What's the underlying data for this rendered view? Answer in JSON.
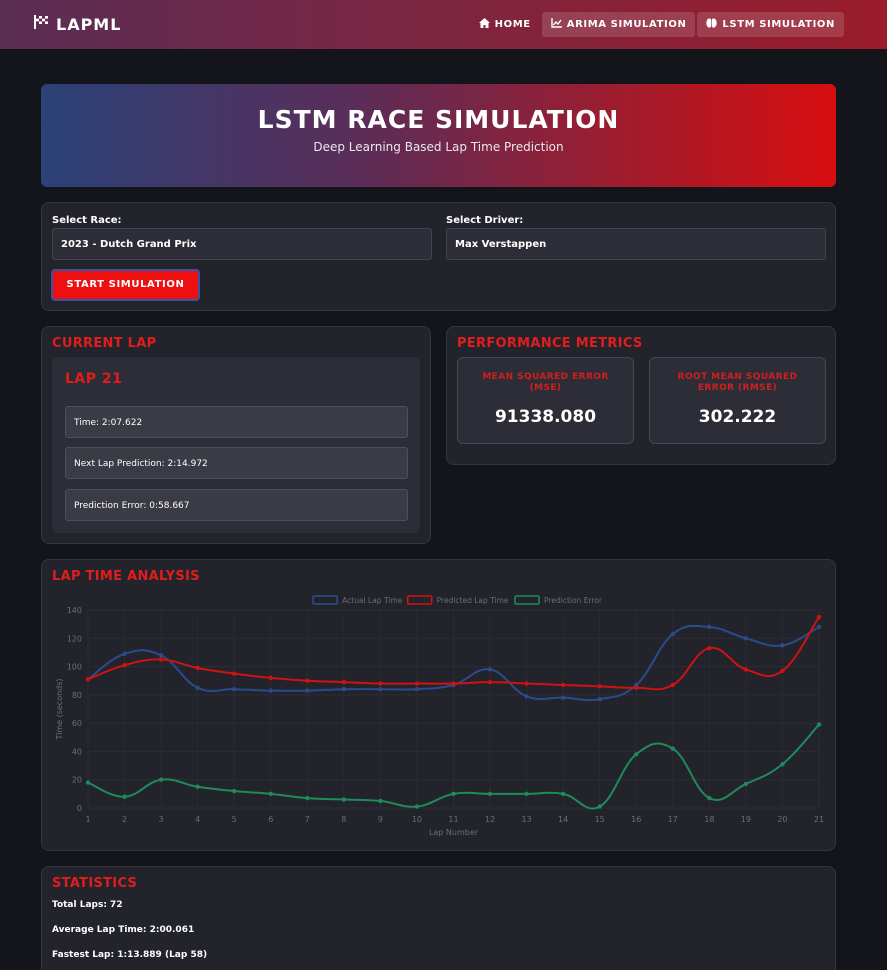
{
  "nav": {
    "brand": "LAPML",
    "links": [
      "HOME",
      "ARIMA SIMULATION",
      "LSTM SIMULATION"
    ]
  },
  "hero": {
    "title": "LSTM RACE SIMULATION",
    "subtitle": "Deep Learning Based Lap Time Prediction"
  },
  "form": {
    "race_label": "Select Race:",
    "race_value": "2023 - Dutch Grand Prix",
    "driver_label": "Select Driver:",
    "driver_value": "Max Verstappen",
    "start_label": "START SIMULATION"
  },
  "current_lap": {
    "title": "CURRENT LAP",
    "lap": "LAP 21",
    "time": "Time: 2:07.622",
    "next_prediction": "Next Lap Prediction: 2:14.972",
    "error": "Prediction Error: 0:58.667"
  },
  "metrics": {
    "title": "PERFORMANCE METRICS",
    "mse_label": "MEAN SQUARED ERROR (MSE)",
    "mse_value": "91338.080",
    "rmse_label": "ROOT MEAN SQUARED ERROR (RMSE)",
    "rmse_value": "302.222"
  },
  "analysis": {
    "title": "LAP TIME ANALYSIS"
  },
  "chart_data": {
    "type": "line",
    "title": "",
    "xlabel": "Lap Number",
    "ylabel": "Time (seconds)",
    "x": [
      1,
      2,
      3,
      4,
      5,
      6,
      7,
      8,
      9,
      10,
      11,
      12,
      13,
      14,
      15,
      16,
      17,
      18,
      19,
      20,
      21
    ],
    "ylim": [
      0,
      140
    ],
    "yticks": [
      0,
      20,
      40,
      60,
      80,
      100,
      120,
      140
    ],
    "legend": "top",
    "grid": true,
    "series": [
      {
        "name": "Actual Lap Time",
        "color": "#2b4c8c",
        "values": [
          91,
          109,
          108,
          85,
          84,
          83,
          83,
          84,
          84,
          84,
          87,
          98,
          79,
          78,
          77,
          87,
          123,
          128,
          120,
          115,
          128
        ]
      },
      {
        "name": "Predicted Lap Time",
        "color": "#d01212",
        "values": [
          91,
          101,
          105,
          99,
          95,
          92,
          90,
          89,
          88,
          88,
          88,
          89,
          88,
          87,
          86,
          85,
          87,
          113,
          98,
          97,
          135
        ]
      },
      {
        "name": "Prediction Error",
        "color": "#1f8a5a",
        "values": [
          18,
          8,
          20,
          15,
          12,
          10,
          7,
          6,
          5,
          1,
          10,
          10,
          10,
          10,
          1,
          38,
          42,
          7,
          17,
          31,
          59
        ]
      }
    ]
  },
  "statistics": {
    "title": "STATISTICS",
    "total_laps": "Total Laps: 72",
    "avg_lap": "Average Lap Time: 2:00.061",
    "fastest_lap": "Fastest Lap: 1:13.889 (Lap 58)"
  },
  "icons": {
    "brand": "checkered-flag-icon",
    "home": "home-icon",
    "arima": "line-chart-icon",
    "lstm": "brain-icon"
  }
}
